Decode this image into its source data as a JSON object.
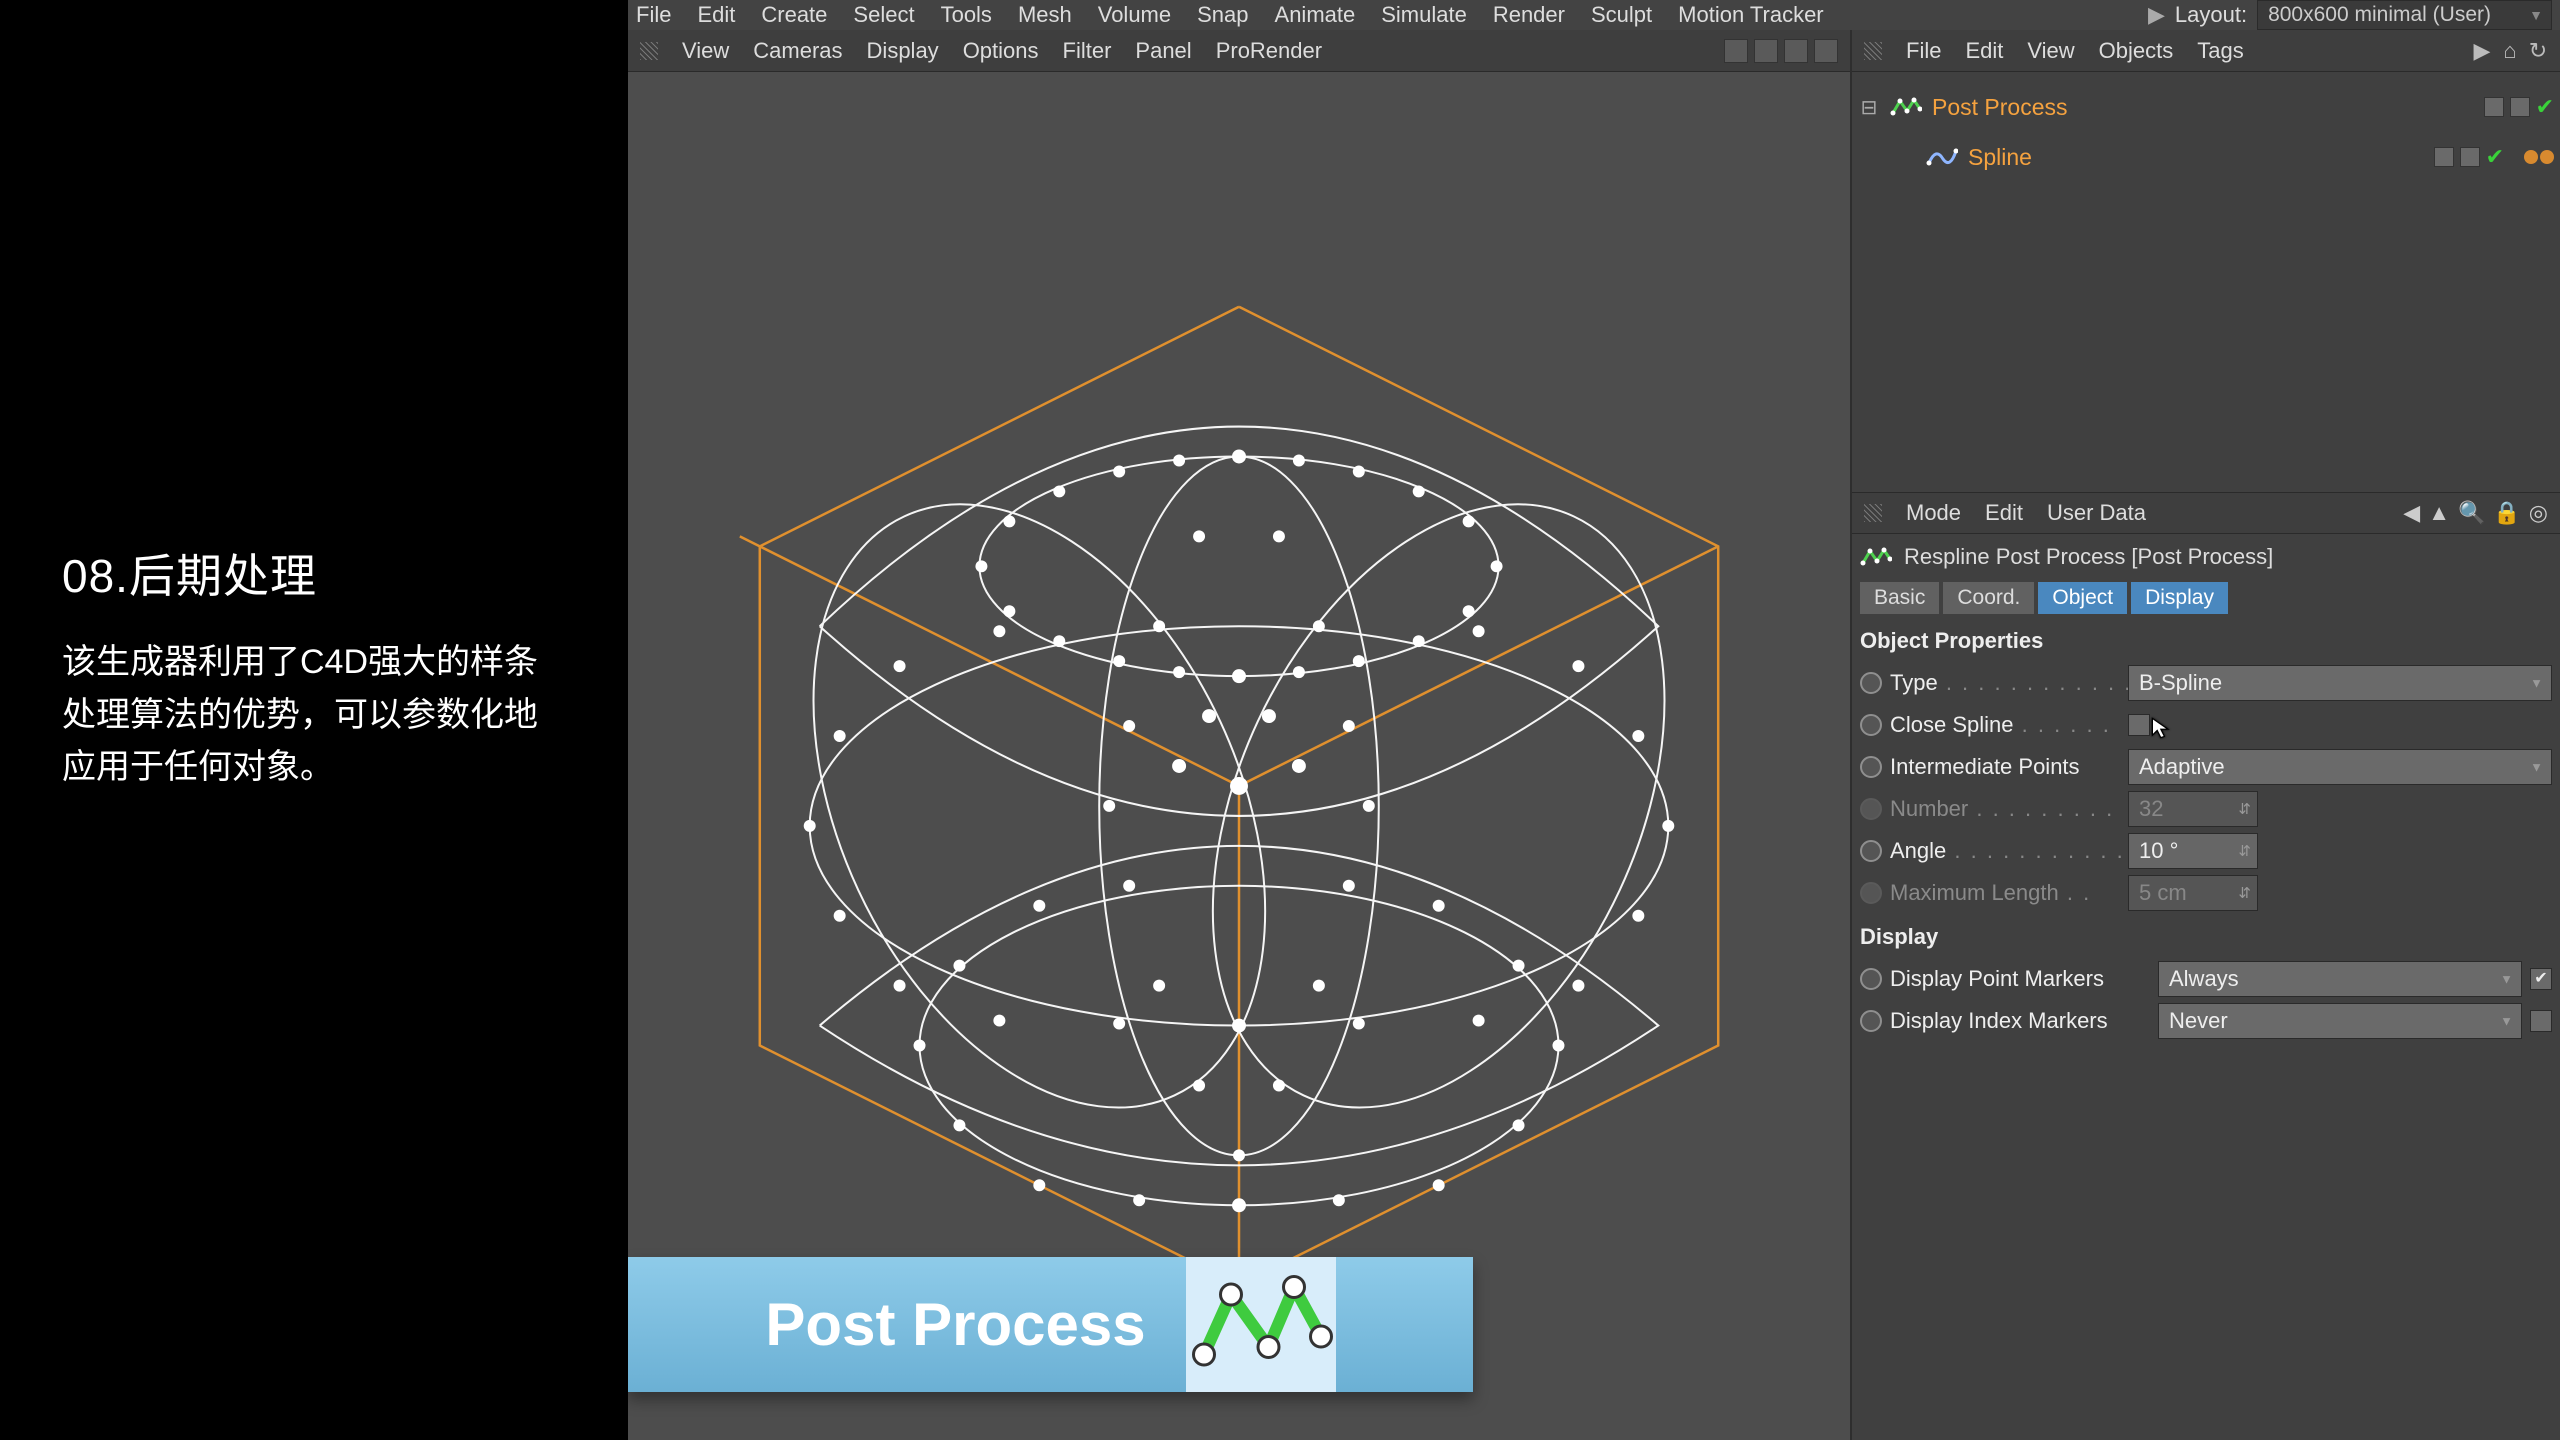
{
  "left": {
    "title": "08.后期处理",
    "body": "该生成器利用了C4D强大的样条处理算法的优势，可以参数化地应用于任何对象。"
  },
  "main_menu": [
    "File",
    "Edit",
    "Create",
    "Select",
    "Tools",
    "Mesh",
    "Volume",
    "Snap",
    "Animate",
    "Simulate",
    "Render",
    "Sculpt",
    "Motion Tracker"
  ],
  "layout_label": "Layout:",
  "layout_value": "800x600 minimal (User)",
  "viewport_menu": [
    "View",
    "Cameras",
    "Display",
    "Options",
    "Filter",
    "Panel",
    "ProRender"
  ],
  "objects_menu": [
    "File",
    "Edit",
    "View",
    "Objects",
    "Tags"
  ],
  "tree": {
    "root": "Post Process",
    "child": "Spline"
  },
  "attr_menu": [
    "Mode",
    "Edit",
    "User Data"
  ],
  "attr_title": "Respline Post Process [Post Process]",
  "tabs": [
    "Basic",
    "Coord.",
    "Object",
    "Display"
  ],
  "section1": "Object Properties",
  "section2": "Display",
  "props": {
    "type_label": "Type",
    "type_value": "B-Spline",
    "close_label": "Close Spline",
    "interp_label": "Intermediate Points",
    "interp_value": "Adaptive",
    "number_label": "Number",
    "number_value": "32",
    "angle_label": "Angle",
    "angle_value": "10 °",
    "maxlen_label": "Maximum Length",
    "maxlen_value": "5 cm",
    "dpm_label": "Display Point Markers",
    "dpm_value": "Always",
    "dim_label": "Display Index Markers",
    "dim_value": "Never"
  },
  "overlay": "Post Process"
}
